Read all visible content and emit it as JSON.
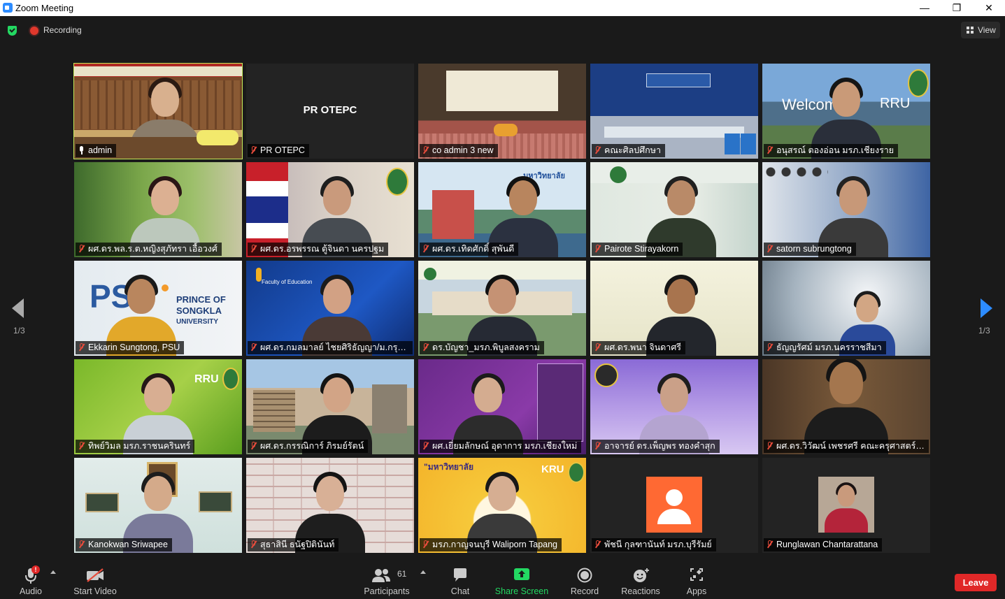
{
  "window": {
    "title": "Zoom Meeting",
    "minimize": "—",
    "maximize": "❐",
    "close": "✕"
  },
  "topbar": {
    "recording_label": "Recording",
    "view_label": "View"
  },
  "pagination": {
    "left": "1/3",
    "right": "1/3"
  },
  "participants": [
    {
      "name": "admin",
      "muted": false,
      "active": true
    },
    {
      "name": "PR OTEPC",
      "muted": true,
      "video": false
    },
    {
      "name": "co admin 3 new",
      "muted": true
    },
    {
      "name": "คณะศิลปศึกษา",
      "muted": true
    },
    {
      "name": "อนุสรณ์ ตองอ่อน มรภ.เชียงราย",
      "muted": true
    },
    {
      "name": "ผศ.ดร.พล.ร.ต.หญิงสุภัทรา เอื้อวงศ์",
      "muted": true
    },
    {
      "name": "ผศ.ดร.อรพรรณ ตู้จินดา นครปฐม",
      "muted": true
    },
    {
      "name": "ผศ.ดร.เทิดศักดิ์ สุพันดี",
      "muted": true
    },
    {
      "name": "Pairote Stirayakorn",
      "muted": true
    },
    {
      "name": "satorn subrungtong",
      "muted": true
    },
    {
      "name": "Ekkarin Sungtong, PSU",
      "muted": true
    },
    {
      "name": "ผศ.ดร.กมลมาลย์ ไชยศิริธัญญา/ม.กรุงเทพ",
      "muted": true
    },
    {
      "name": "ดร.บัญชา_มรภ.พิบูลสงคราม",
      "muted": true
    },
    {
      "name": "ผศ.ดร.พนา จินดาศรี",
      "muted": true
    },
    {
      "name": "ธัญญรัศม์ มรภ.นครราชสีมา",
      "muted": true
    },
    {
      "name": "ทิพย์วิมล มรภ.ราชนครินทร์",
      "muted": true
    },
    {
      "name": "ผศ.ดร.กรรณิการ์ ภิรมย์รัตน์",
      "muted": true
    },
    {
      "name": "ผศ.เยี่ยมลักษณ์ อุดาการ มรภ.เชียงใหม่",
      "muted": true
    },
    {
      "name": "อาจารย์ ดร.เพ็ญพร ทองคำสุก",
      "muted": true
    },
    {
      "name": "ผศ.ดร.วิวัฒน์ เพชรศรี คณะครุศาสตร์/มรภ.",
      "muted": true
    },
    {
      "name": "Kanokwan Sriwapee",
      "muted": true
    },
    {
      "name": "สุธาสินี ธนัฐปิตินันท์",
      "muted": true
    },
    {
      "name": "มรภ.กาญจนบุรี Waliporn Tapang",
      "muted": true
    },
    {
      "name": "พัชนี กุลฑานันท์ มรภ.บุรีรัมย์",
      "muted": true,
      "video": false
    },
    {
      "name": "Runglawan Chantarattana",
      "muted": true,
      "video": false
    }
  ],
  "tile_text": {
    "welcome": "Welcome",
    "rru": "RRU",
    "kru": "KRU",
    "prince": "PRINCE OF",
    "songkla": "SONGKLA",
    "university": "UNIVERSITY",
    "faculty": "Faculty of Education"
  },
  "toolbar": {
    "audio": "Audio",
    "start_video": "Start Video",
    "participants": "Participants",
    "participant_count": "61",
    "chat": "Chat",
    "share_screen": "Share Screen",
    "record": "Record",
    "reactions": "Reactions",
    "apps": "Apps",
    "leave": "Leave",
    "audio_alert": "!"
  },
  "colors": {
    "accent": "#2d8cff",
    "share": "#23d962",
    "leave": "#e02828",
    "active_speaker": "#c6ec5a"
  }
}
